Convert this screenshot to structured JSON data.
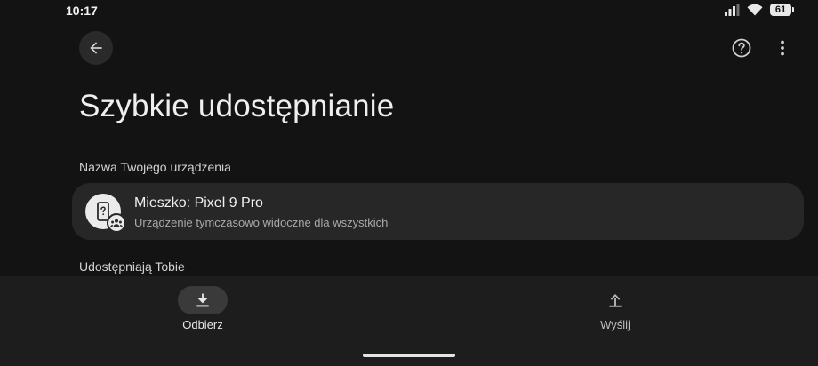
{
  "status_bar": {
    "time": "10:17",
    "battery_level": "61",
    "icons": [
      "signal-icon",
      "wifi-icon",
      "battery-icon"
    ]
  },
  "app_bar": {
    "icons": [
      "arrow-back-icon",
      "help-icon",
      "more-vert-icon"
    ]
  },
  "page": {
    "title": "Szybkie udostępnianie"
  },
  "device_section": {
    "label": "Nazwa Twojego urządzenia",
    "device_name": "Mieszko: Pixel 9 Pro",
    "visibility": "Urządzenie tymczasowo widoczne dla wszystkich",
    "icons": [
      "phone-unknown-icon",
      "group-icon"
    ]
  },
  "shared_section": {
    "label": "Udostępniają Tobie"
  },
  "bottom_nav": {
    "items": [
      {
        "label": "Odbierz",
        "icon": "download-icon",
        "selected": true
      },
      {
        "label": "Wyślij",
        "icon": "upload-icon",
        "selected": false
      }
    ]
  },
  "colors": {
    "background": "#131313",
    "card": "#272727",
    "nav_background": "#1d1d1d",
    "selected_pill": "#3a3a3a"
  }
}
